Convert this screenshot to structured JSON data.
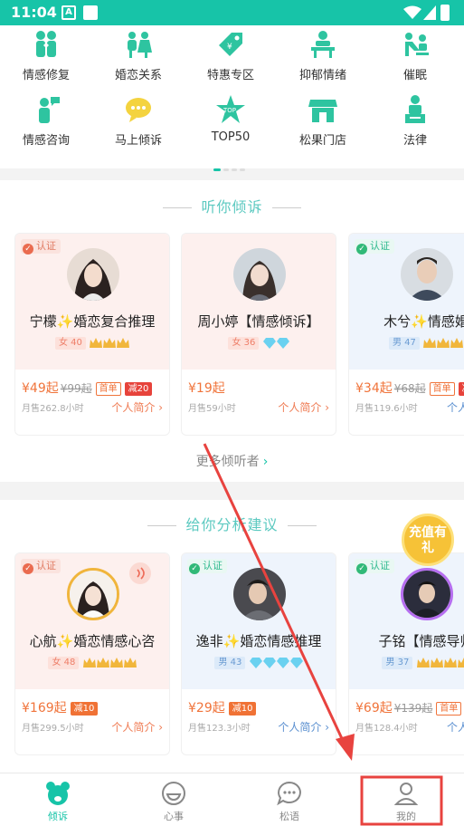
{
  "status_bar": {
    "time": "11:04",
    "notification_icon": "A"
  },
  "categories": [
    {
      "label": "情感修复",
      "icon": "couple-repair-icon"
    },
    {
      "label": "婚恋关系",
      "icon": "marriage-icon"
    },
    {
      "label": "特惠专区",
      "icon": "discount-tag-icon"
    },
    {
      "label": "抑郁情绪",
      "icon": "depression-icon"
    },
    {
      "label": "催眠",
      "icon": "hypnosis-icon"
    },
    {
      "label": "情感咨询",
      "icon": "consult-icon"
    },
    {
      "label": "马上倾诉",
      "icon": "chat-bubble-icon"
    },
    {
      "label": "TOP50",
      "icon": "top-star-icon"
    },
    {
      "label": "松果门店",
      "icon": "store-icon"
    },
    {
      "label": "法律",
      "icon": "law-icon"
    }
  ],
  "listen_section": {
    "title": "听你倾诉",
    "more": "更多倾听者",
    "cards": [
      {
        "cert": "认证",
        "name": "宁檬✨婚恋复合推理",
        "gender": "女",
        "age": "40",
        "badges": 3,
        "price": "¥49起",
        "old_price": "¥99起",
        "tags": [
          "首单",
          "减20"
        ],
        "sales": "月售262.8小时",
        "intro": "个人简介 ›"
      },
      {
        "cert": "",
        "name": "周小婷【情感倾诉】",
        "gender": "女",
        "age": "36",
        "badges": 2,
        "price": "¥19起",
        "old_price": "",
        "tags": [],
        "sales": "月售59小时",
        "intro": "个人简介 ›"
      },
      {
        "cert": "认证",
        "name": "木兮✨情感婚",
        "gender": "男",
        "age": "47",
        "badges": 3,
        "price": "¥34起",
        "old_price": "¥68起",
        "tags": [
          "首单",
          "减"
        ],
        "sales": "月售119.6小时",
        "intro": "个人"
      }
    ]
  },
  "advice_section": {
    "title": "给你分析建议",
    "promo": "充值有礼",
    "cards": [
      {
        "cert": "认证",
        "name": "心航✨婚恋情感心咨",
        "gender": "女",
        "age": "48",
        "badges": 4,
        "price": "¥169起",
        "old_price": "",
        "tags": [
          "减10"
        ],
        "sales": "月售299.5小时",
        "intro": "个人简介 ›"
      },
      {
        "cert": "认证",
        "name": "逸非✨婚恋情感推理",
        "gender": "男",
        "age": "43",
        "badges": 4,
        "price": "¥29起",
        "old_price": "",
        "tags": [
          "减10"
        ],
        "sales": "月售123.3小时",
        "intro": "个人简介 ›"
      },
      {
        "cert": "认证",
        "name": "子铭【情感导师",
        "gender": "男",
        "age": "37",
        "badges": 4,
        "price": "¥69起",
        "old_price": "¥139起",
        "tags": [
          "首单",
          "减"
        ],
        "sales": "月售128.4小时",
        "intro": "个人"
      }
    ]
  },
  "bottom_nav": [
    {
      "label": "倾诉",
      "icon": "bear-icon",
      "active": true
    },
    {
      "label": "心事",
      "icon": "mood-face-icon",
      "active": false
    },
    {
      "label": "松语",
      "icon": "chat-dots-icon",
      "active": false
    },
    {
      "label": "我的",
      "icon": "user-profile-icon",
      "active": false
    }
  ],
  "colors": {
    "accent": "#17c4a8",
    "price": "#f0743b",
    "annotation": "#e8433f"
  }
}
